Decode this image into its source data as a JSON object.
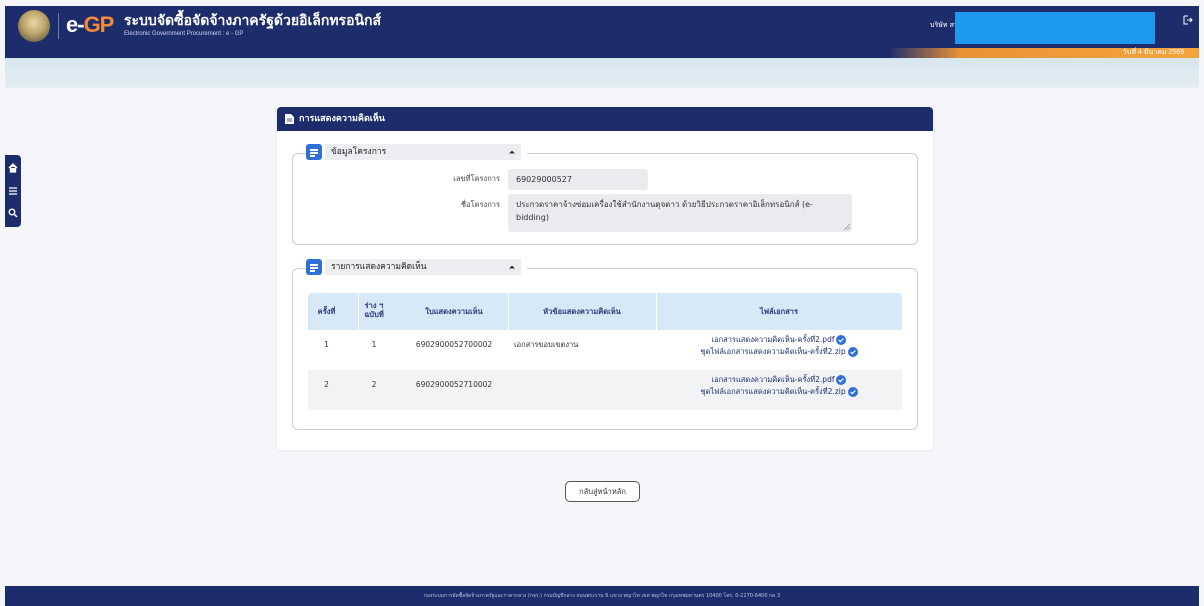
{
  "header": {
    "logo_e": "e-",
    "logo_gp": "GP",
    "title": "ระบบจัดซื้อจัดจ้างภาครัฐด้วยอิเล็กทรอนิกส์",
    "subtitle": "Electronic Government Procurement : e - GP",
    "company": "บริษัท สหมิ",
    "date": "วันที่ 4 มีนาคม 2569"
  },
  "card": {
    "title": "การแสดงความคิดเห็น",
    "project_section": {
      "legend": "ข้อมูลโครงการ",
      "project_no_label": "เลขที่โครงการ",
      "project_no": "69029000527",
      "project_name_label": "ชื่อโครงการ",
      "project_name": "ประกวดราคาจ้างซ่อมเครื่องใช้สำนักงานดุจดาว ด้วยวิธีประกวดราคาอิเล็กทรอนิกส์ (e-bidding)"
    },
    "comments_section": {
      "legend": "รายการแสดงความคิดเห็น",
      "columns": [
        "ครั้งที่",
        "ร่าง ฯ ฉบับที่",
        "ใบแสดงความเห็น",
        "หัวข้อแสดงความคิดเห็น",
        "ไฟล์เอกสาร"
      ],
      "rows": [
        {
          "round": "1",
          "draft": "1",
          "comment_no": "6902900052700002",
          "topic": "เอกสารขอบเขตงาน",
          "files": [
            "เอกสารแสดงความคิดเห็น-ครั้งที่2.pdf",
            "ชุดไฟล์เอกสารแสดงความคิดเห็น-ครั้งที่2.zip"
          ]
        },
        {
          "round": "2",
          "draft": "2",
          "comment_no": "6902900052710002",
          "topic": "",
          "files": [
            "เอกสารแสดงความคิดเห็น-ครั้งที่2.pdf",
            "ชุดไฟล์เอกสารแสดงความคิดเห็น-ครั้งที่2.zip"
          ]
        }
      ]
    }
  },
  "back_button": "กลับสู่หน้าหลัก",
  "footer": "กองระบบการจัดซื้อจัดจ้างภาครัฐและราคากลาง (กจร.) กรมบัญชีกลาง ถนนพระราม 6 แขวง พญาไท เขต พญาไท กรุงเทพมหานคร 10400 โทร. 0-2270-6400 กด 3",
  "colors": {
    "navy": "#1d2d6b",
    "orange": "#f28a3a",
    "accent_blue": "#2f6fd8",
    "table_head": "#d7e8f6"
  },
  "icons": [
    "emblem-icon",
    "logout-icon",
    "home-icon",
    "menu-icon",
    "search-icon",
    "document-icon",
    "list-icon",
    "caret-up-icon",
    "verified-check-icon"
  ]
}
